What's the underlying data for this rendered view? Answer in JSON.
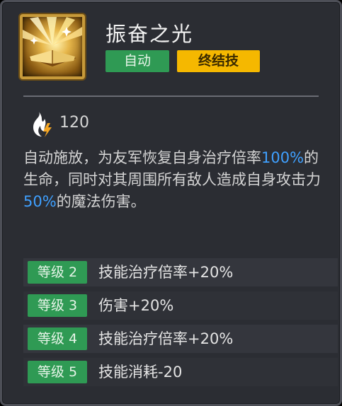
{
  "skill": {
    "title": "振奋之光",
    "tags": {
      "auto": "自动",
      "ultimate": "终结技"
    },
    "cost": {
      "icon": "energy-flame-icon",
      "value": "120"
    },
    "description": {
      "part1": "自动施放，为友军恢复自身治疗倍率",
      "hl1": "100%",
      "part2": "的生命，同时对其周围所有敌人造成自身攻击力",
      "hl2": "50%",
      "part3": "的魔法伤害。"
    },
    "levels": [
      {
        "badge": "等级 2",
        "text": "技能治疗倍率+20%"
      },
      {
        "badge": "等级 3",
        "text": "伤害+20%"
      },
      {
        "badge": "等级 4",
        "text": "技能治疗倍率+20%"
      },
      {
        "badge": "等级 5",
        "text": "技能消耗-20"
      }
    ]
  },
  "colors": {
    "highlight": "#3fa0ff",
    "auto_tag": "#2f9a54",
    "ultimate_tag": "#f5b800",
    "level_badge": "#2f9a54"
  }
}
